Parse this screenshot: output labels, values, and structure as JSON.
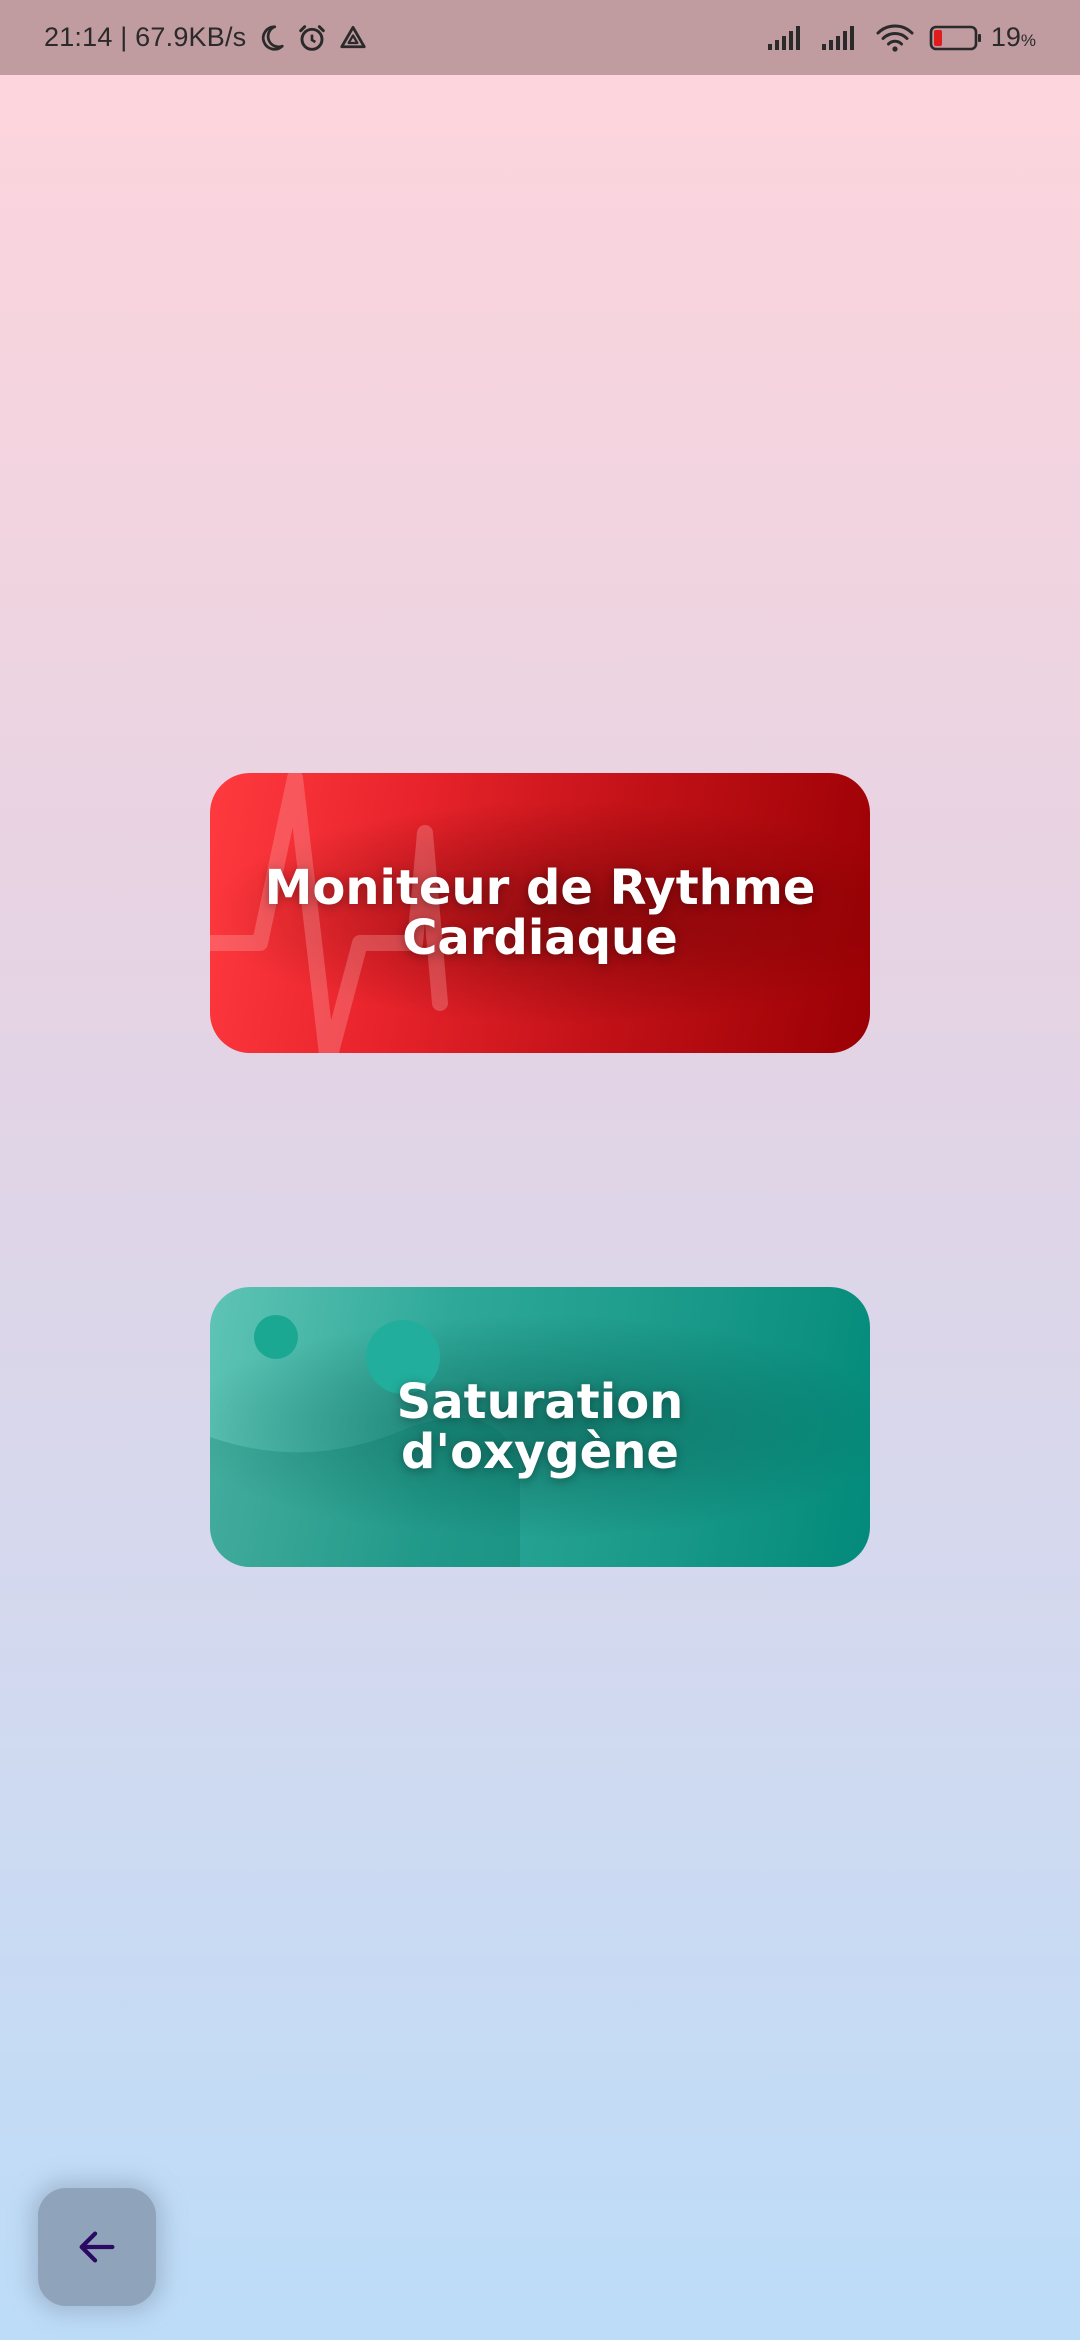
{
  "status_bar": {
    "time_speed": "21:14 | 67.9KB/s",
    "icons_left": [
      "moon-icon",
      "alarm-icon",
      "drive-icon"
    ],
    "icons_right": [
      "signal-icon",
      "signal-icon",
      "wifi-icon",
      "battery-icon"
    ],
    "battery_percent": "19",
    "battery_unit": "%",
    "battery_level": 0.19
  },
  "cards": {
    "heart_rate": {
      "label": "Moniteur de Rythme Cardiaque",
      "color_start": "#ff3a3f",
      "color_end": "#9a0004"
    },
    "oxygen": {
      "label": "Saturation d'oxygène",
      "color_start": "#5fc4b5",
      "color_end": "#038a7a"
    }
  },
  "back_button": {
    "icon": "arrow-left-icon",
    "icon_color": "#2b0a63"
  }
}
